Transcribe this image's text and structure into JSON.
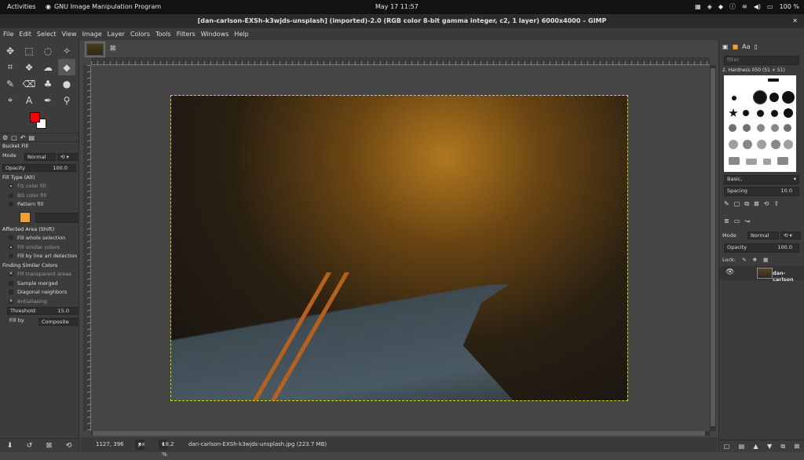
{
  "topbar": {
    "activities": "Activities",
    "app_name": "GNU Image Manipulation Program",
    "clock": "May 17  11:57",
    "battery": "100 %"
  },
  "window": {
    "title": "[dan-carlson-EXSh-k3wjds-unsplash] (imported)-2.0 (RGB color 8-bit gamma integer, c2, 1 layer) 6000x4000 – GIMP"
  },
  "menu": [
    "File",
    "Edit",
    "Select",
    "View",
    "Image",
    "Layer",
    "Colors",
    "Tools",
    "Filters",
    "Windows",
    "Help"
  ],
  "colors": {
    "foreground": "#ff0000",
    "background": "#ffffff"
  },
  "tool_options": {
    "title": "Bucket Fill",
    "mode_label": "Mode",
    "mode_value": "Normal",
    "opacity_label": "Opacity",
    "opacity_value": "100.0",
    "fill_type": "Fill Type  (Alt)",
    "fg_fill": "FG color fill",
    "bg_fill": "BG color fill",
    "pattern_fill": "Pattern fill",
    "affected_area": "Affected Area  (Shift)",
    "fill_whole": "Fill whole selection",
    "fill_similar": "Fill similar colors",
    "fill_line_art": "Fill by line art detection",
    "finding": "Finding Similar Colors",
    "fill_transparent": "Fill transparent areas",
    "sample_merged": "Sample merged",
    "diagonal": "Diagonal neighbors",
    "antialiasing": "Antialiasing",
    "threshold_label": "Threshold",
    "threshold_value": "15.0",
    "fill_by_label": "Fill by",
    "fill_by_value": "Composite"
  },
  "status": {
    "coords": "1127, 396",
    "unit": "px",
    "zoom": "18.2 %",
    "file": "dan-carlson-EXSh-k3wjds-unsplash.jpg (223.7 MB)"
  },
  "brushes": {
    "filter_placeholder": "filter",
    "current": "2. Hardness 050 (51 × 51)",
    "tag": "Basic,",
    "spacing_label": "Spacing",
    "spacing_value": "10.0"
  },
  "layers": {
    "mode_label": "Mode",
    "mode_value": "Normal",
    "opacity_label": "Opacity",
    "opacity_value": "100.0",
    "lock_label": "Lock:",
    "layer_name": "dan-carlson"
  }
}
